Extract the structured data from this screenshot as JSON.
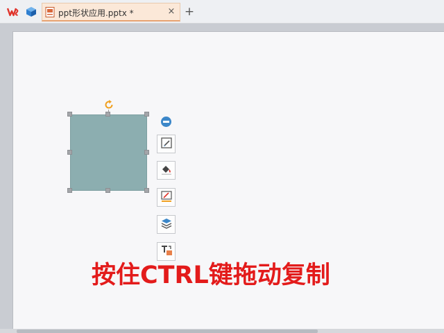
{
  "tabbar": {
    "document_tab_title": "ppt形状应用.pptx *",
    "close_glyph": "×",
    "new_tab_glyph": "+",
    "icons": [
      "wps-logo-icon",
      "cube-icon",
      "presentation-file-icon"
    ]
  },
  "toolbar": {
    "buttons": [
      "collapse-icon",
      "shape-style-icon",
      "fill-bucket-icon",
      "outline-pen-icon",
      "layers-icon",
      "text-frame-icon"
    ]
  },
  "slide": {
    "shape_fill": "#8caeb0",
    "caption": "按住CTRL键拖动复制",
    "caption_color": "#e31b1b"
  }
}
